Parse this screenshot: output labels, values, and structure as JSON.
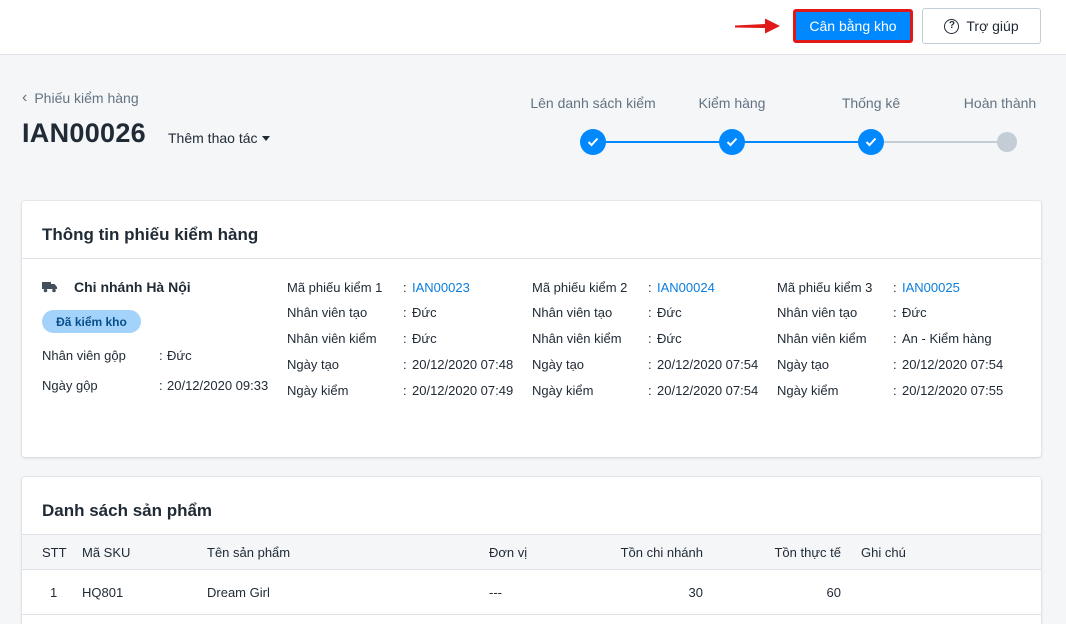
{
  "topbar": {
    "balance_label": "Cân bằng kho",
    "help_label": "Trợ giúp"
  },
  "header": {
    "back_label": "Phiếu kiểm hàng",
    "code": "IAN00026",
    "more_label": "Thêm thao tác"
  },
  "steps": [
    {
      "label": "Lên danh sách kiểm",
      "done": true
    },
    {
      "label": "Kiểm hàng",
      "done": true
    },
    {
      "label": "Thống kê",
      "done": true
    },
    {
      "label": "Hoàn thành",
      "done": false
    }
  ],
  "info": {
    "title": "Thông tin phiếu kiểm hàng",
    "branch": "Chi nhánh Hà Nội",
    "status": "Đã kiểm kho",
    "merger_label": "Nhân viên gộp",
    "merger_value": "Đức",
    "merge_date_label": "Ngày gộp",
    "merge_date_value": "20/12/2020 09:33",
    "columns": [
      {
        "rows": [
          {
            "label": "Mã phiếu kiểm 1",
            "value": "IAN00023",
            "link": true
          },
          {
            "label": "Nhân viên tạo",
            "value": "Đức"
          },
          {
            "label": "Nhân viên kiểm",
            "value": "Đức"
          },
          {
            "label": "Ngày tạo",
            "value": "20/12/2020 07:48"
          },
          {
            "label": "Ngày kiểm",
            "value": "20/12/2020 07:49"
          }
        ]
      },
      {
        "rows": [
          {
            "label": "Mã phiếu kiểm 2",
            "value": "IAN00024",
            "link": true
          },
          {
            "label": "Nhân viên tạo",
            "value": "Đức"
          },
          {
            "label": "Nhân viên kiểm",
            "value": "Đức"
          },
          {
            "label": "Ngày tạo",
            "value": "20/12/2020 07:54"
          },
          {
            "label": "Ngày kiểm",
            "value": "20/12/2020 07:54"
          }
        ]
      },
      {
        "rows": [
          {
            "label": "Mã phiếu kiểm 3",
            "value": "IAN00025",
            "link": true
          },
          {
            "label": "Nhân viên tạo",
            "value": "Đức"
          },
          {
            "label": "Nhân viên kiểm",
            "value": "An - Kiểm hàng"
          },
          {
            "label": "Ngày tạo",
            "value": "20/12/2020 07:54"
          },
          {
            "label": "Ngày kiểm",
            "value": "20/12/2020 07:55"
          }
        ]
      }
    ]
  },
  "products": {
    "title": "Danh sách sản phẩm",
    "headers": {
      "stt": "STT",
      "sku": "Mã SKU",
      "name": "Tên sản phẩm",
      "unit": "Đơn vị",
      "branch_stock": "Tồn chi nhánh",
      "actual_stock": "Tồn thực tế",
      "note": "Ghi chú"
    },
    "rows": [
      {
        "stt": "1",
        "sku": "HQ801",
        "name": "Dream Girl",
        "unit": "---",
        "branch_stock": "30",
        "actual_stock": "60",
        "note": ""
      }
    ]
  },
  "colors": {
    "primary": "#0088ff",
    "highlight_border": "#e01818",
    "link": "#0a7ee0",
    "badge_bg": "#a3d3fb",
    "step_inactive": "#c4cdd5"
  }
}
